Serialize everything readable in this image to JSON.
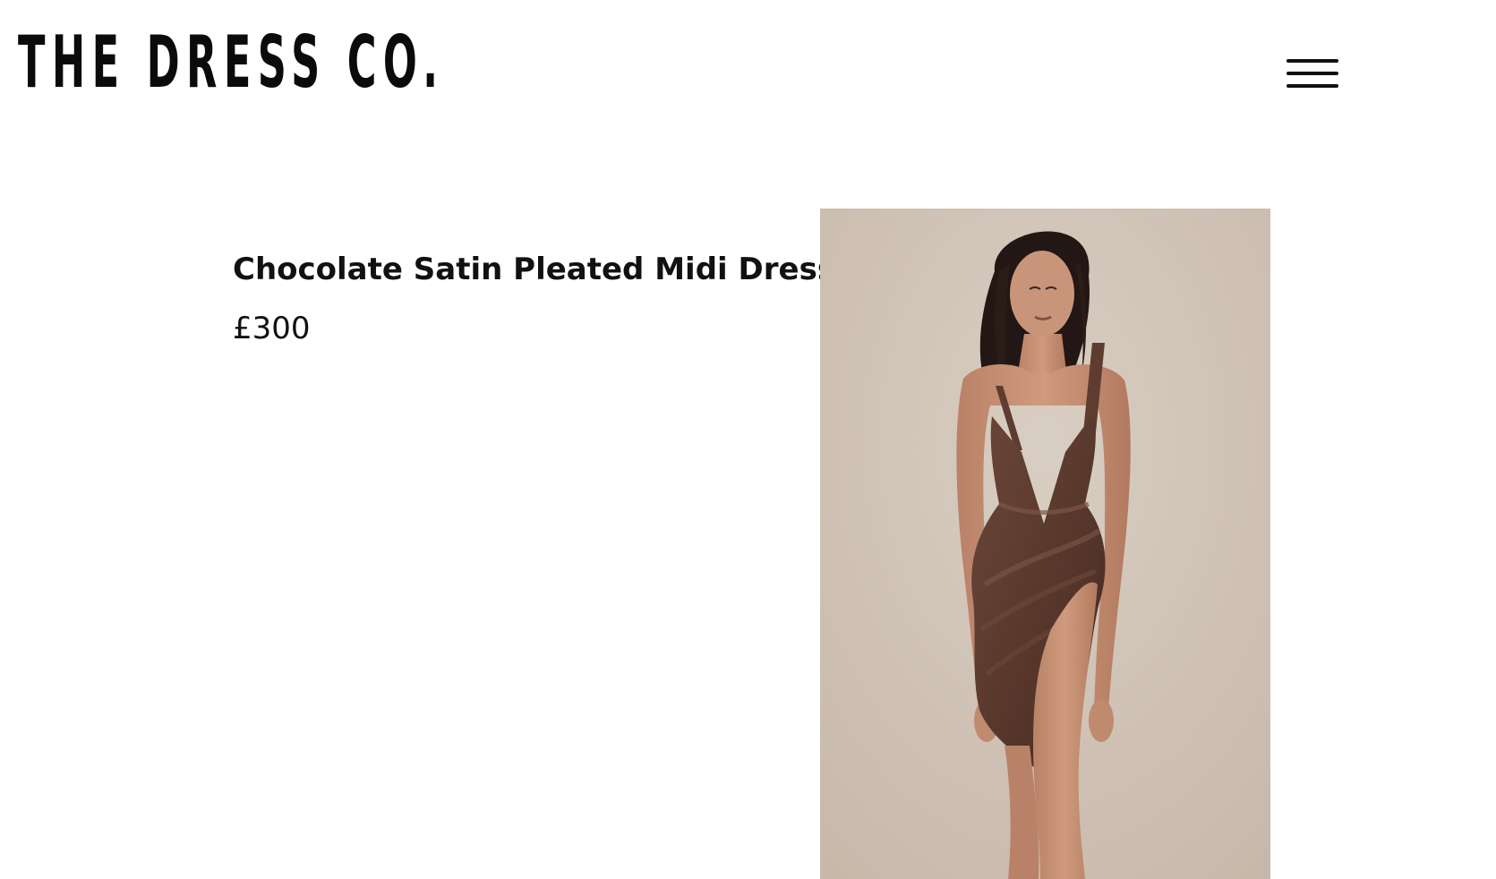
{
  "header": {
    "logo_text": "THE DRESS CO.",
    "menu_icon": "hamburger-menu-icon"
  },
  "product": {
    "title": "Chocolate Satin Pleated Midi Dress",
    "price": "£300",
    "image_subject": "model-in-chocolate-satin-dress",
    "colors": {
      "background": "#ffffff",
      "text": "#111111",
      "backdrop": "#cfc3b6",
      "dress": "#5a3a2d",
      "skin": "#c48f73",
      "hair": "#221714"
    }
  }
}
